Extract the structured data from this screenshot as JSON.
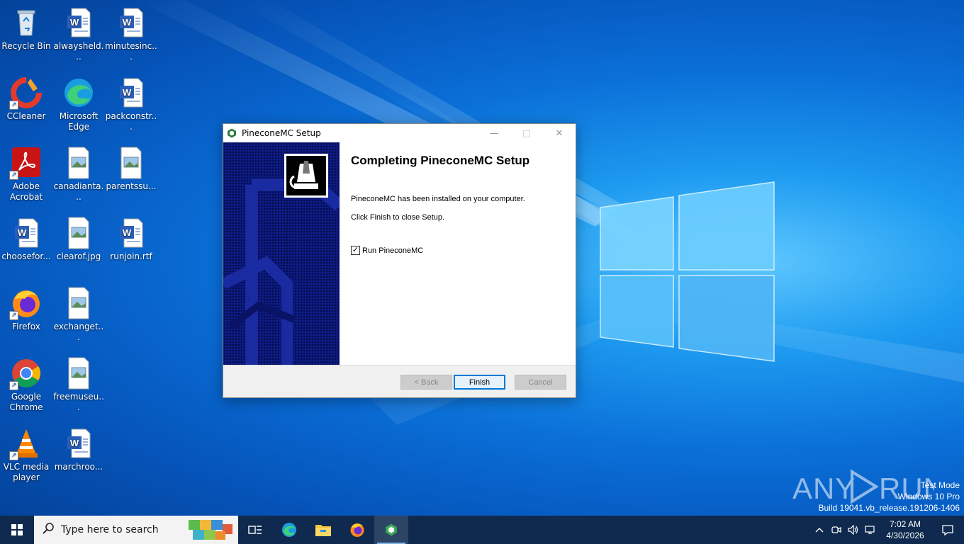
{
  "desktop": {
    "icons": [
      {
        "label": "Recycle Bin"
      },
      {
        "label": "alwaysheld..."
      },
      {
        "label": "minutesinc..."
      },
      {
        "label": "CCleaner"
      },
      {
        "label": "Microsoft Edge"
      },
      {
        "label": "packconstr..."
      },
      {
        "label": "Adobe Acrobat"
      },
      {
        "label": "canadianta..."
      },
      {
        "label": "parentssu..."
      },
      {
        "label": "choosefor..."
      },
      {
        "label": "clearof.jpg"
      },
      {
        "label": "runjoin.rtf"
      },
      {
        "label": "Firefox"
      },
      {
        "label": "exchanget..."
      },
      {
        "label": "Google Chrome"
      },
      {
        "label": "freemuseu..."
      },
      {
        "label": "VLC media player"
      },
      {
        "label": "marchroo..."
      }
    ]
  },
  "dialog": {
    "title": "PineconeMC Setup",
    "heading": "Completing PineconeMC Setup",
    "line1": "PineconeMC has been installed on your computer.",
    "line2": "Click Finish to close Setup.",
    "checkbox_label": "Run PineconeMC",
    "checkbox_checked": true,
    "back_label": "< Back",
    "finish_label": "Finish",
    "cancel_label": "Cancel"
  },
  "watermark": {
    "line1": "Test Mode",
    "line2": "Windows 10 Pro",
    "line3": "Build 19041.vb_release.191206-1406",
    "logo_text": "ANY RUN"
  },
  "taskbar": {
    "search_placeholder": "Type here to search",
    "time": "7:02 AM",
    "date": "4/30/2026"
  },
  "colors": {
    "taskbar": "#0f2a4e",
    "accent": "#0078d7",
    "banner": "#0d1a80"
  }
}
